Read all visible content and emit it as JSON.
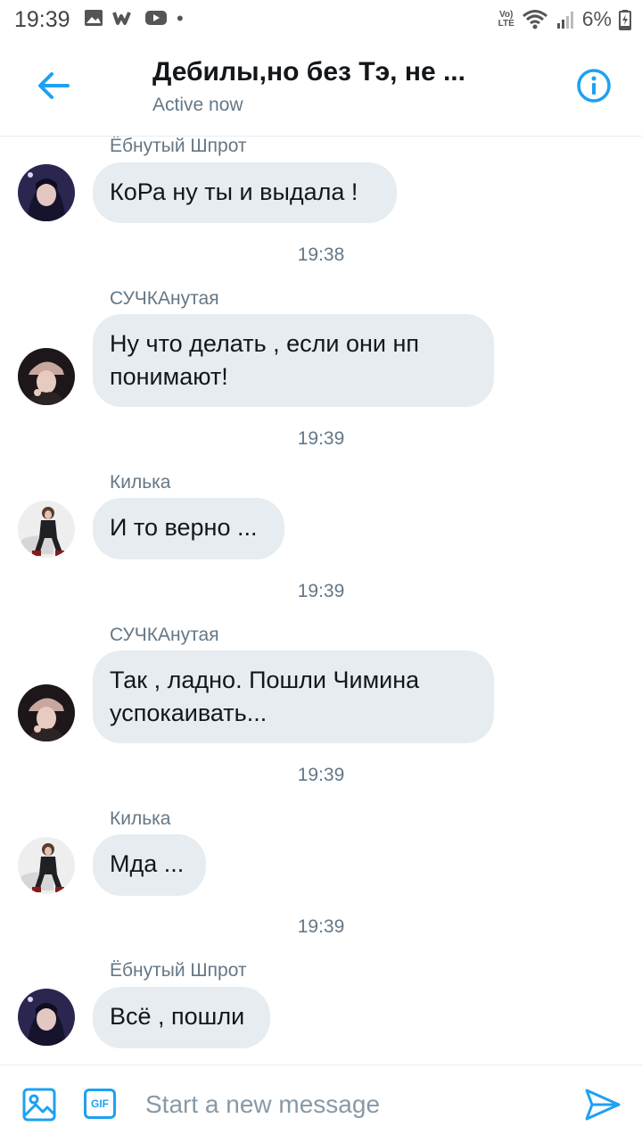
{
  "status_bar": {
    "time": "19:39",
    "lte_top": "Vo)",
    "lte_bottom": "LTE",
    "battery": "6%"
  },
  "header": {
    "title": "Дебилы,но без Тэ, не ...",
    "status": "Active now",
    "accent": "#1da1f2"
  },
  "messages": [
    {
      "sender": "Ёбнутый Шпрот",
      "text": "КоРа ну ты и выдала !",
      "time": "19:38",
      "avatar": "avatar-shprot"
    },
    {
      "sender": "СУЧКАнутая",
      "text": "Ну что делать , если они нп понимают!",
      "time": "19:39",
      "avatar": "avatar-suchka"
    },
    {
      "sender": "Килька",
      "text": "И то верно ...",
      "time": "19:39",
      "avatar": "avatar-kilka"
    },
    {
      "sender": "СУЧКАнутая",
      "text": "Так , ладно. Пошли Чимина успокаивать...",
      "time": "19:39",
      "avatar": "avatar-suchka"
    },
    {
      "sender": "Килька",
      "text": "Мда ...",
      "time": "19:39",
      "avatar": "avatar-kilka"
    },
    {
      "sender": "Ёбнутый Шпрот",
      "text": "Всё , пошли",
      "time": "",
      "avatar": "avatar-shprot"
    }
  ],
  "composer": {
    "placeholder": "Start a new message",
    "gif_label": "GIF"
  }
}
